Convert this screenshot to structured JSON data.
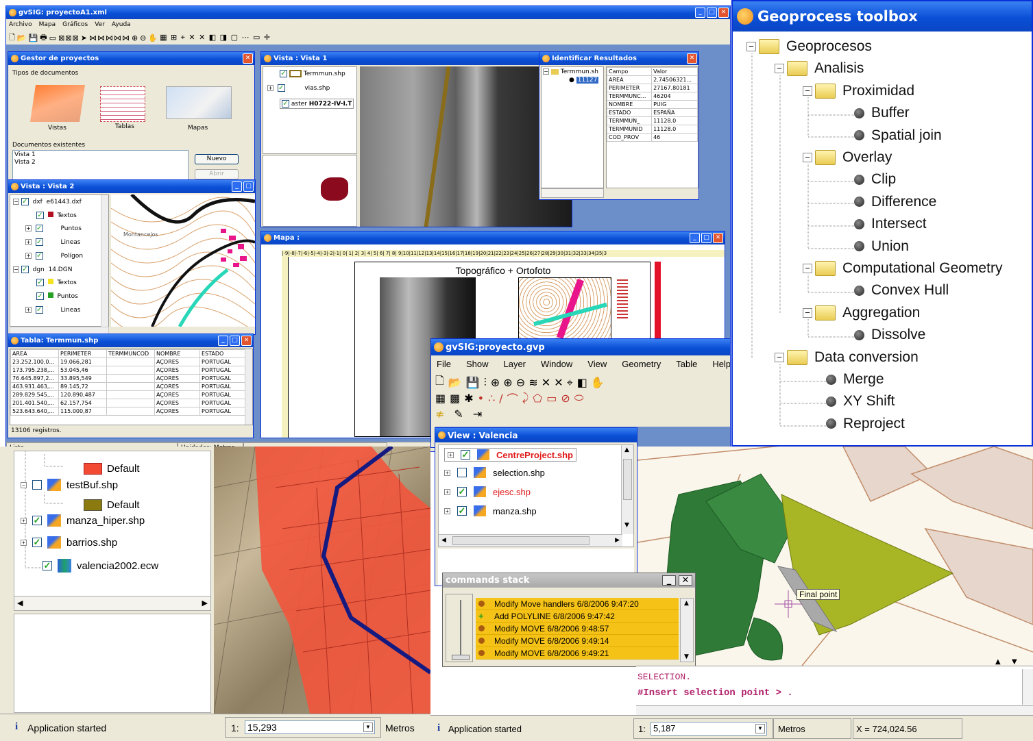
{
  "main": {
    "title": "gvSIG: proyectoA1.xml",
    "menu": [
      "Archivo",
      "Mapa",
      "Gráficos",
      "Ver",
      "Ayuda"
    ],
    "status": "Listo",
    "units": "Unidades: Metros"
  },
  "gestor": {
    "title": "Gestor de proyectos",
    "types_label": "Tipos de documentos",
    "types": [
      "Vistas",
      "Tablas",
      "Mapas"
    ],
    "docs_label": "Documentos existentes",
    "docs": [
      "Vista 1",
      "Vista 2"
    ],
    "new_btn": "Nuevo",
    "open_btn": "Abrir"
  },
  "vista1": {
    "title": "Vista : Vista 1",
    "layers": [
      "Termmun.shp",
      "vias.shp",
      "H0722-IV-I.T"
    ],
    "layer3_prefix": "aster"
  },
  "ident": {
    "title": "Identificar Resultados",
    "tree_root": "Termmun.sh",
    "tree_item": "11127",
    "col_field": "Campo",
    "col_value": "Valor",
    "rows": [
      [
        "AREA",
        "2.74506321..."
      ],
      [
        "PERIMETER",
        "27167.80181"
      ],
      [
        "TERMMUNC...",
        "46204"
      ],
      [
        "NOMBRE",
        "PUIG"
      ],
      [
        "ESTADO",
        "ESPAÑA"
      ],
      [
        "TERMMUN_",
        "11128.0"
      ],
      [
        "TERMMUNID",
        "11128.0"
      ],
      [
        "COD_PROV",
        "46"
      ]
    ]
  },
  "vista2": {
    "title": "Vista : Vista 2",
    "layers": [
      {
        "kind": "dxf",
        "name": "e61443.dxf"
      },
      {
        "name": "Textos"
      },
      {
        "name": "Puntos"
      },
      {
        "name": "Lineas"
      },
      {
        "name": "Polígon"
      },
      {
        "kind": "dgn",
        "name": "14.DGN"
      },
      {
        "name": "Textos"
      },
      {
        "name": "Puntos"
      },
      {
        "name": "Lineas"
      }
    ],
    "map_label": "Montancejos"
  },
  "tabla": {
    "title": "Tabla: Termmun.shp",
    "headers": [
      "AREA",
      "PERIMETER",
      "TERMMUNCOD",
      "NOMBRE",
      "ESTADO"
    ],
    "rows": [
      [
        "23.252.100,0...",
        "19.066,281",
        "",
        "AÇORES",
        "PORTUGAL"
      ],
      [
        "173.795.238,...",
        "53.045,46",
        "",
        "AÇORES",
        "PORTUGAL"
      ],
      [
        "76.645.897,2...",
        "33.895,549",
        "",
        "AÇORES",
        "PORTUGAL"
      ],
      [
        "463.931.463,...",
        "89.145,72",
        "",
        "AÇORES",
        "PORTUGAL"
      ],
      [
        "289.829.545,...",
        "120.890,487",
        "",
        "AÇORES",
        "PORTUGAL"
      ],
      [
        "201.401.540,...",
        "62.157,754",
        "",
        "AÇORES",
        "PORTUGAL"
      ],
      [
        "523.643.640,...",
        "115.000,87",
        "",
        "AÇORES",
        "PORTUGAL"
      ]
    ],
    "count": "13106 registros."
  },
  "mapa": {
    "title": "Mapa :",
    "heading": "Topográfico + Ortofoto",
    "ruler": "|-9|-8|-7|-6|-5|-4|-3|-2|-1| 0| 1| 2| 3| 4| 5| 6| 7| 8| 9|10|11|12|13|14|15|16|17|18|19|20|21|22|23|24|25|26|27|28|29|30|31|32|33|34|35|3"
  },
  "toolbox": {
    "title": "Geoprocess toolbox",
    "tree": [
      {
        "label": "Geoprocesos",
        "kind": "folder"
      },
      {
        "label": "Analisis",
        "kind": "folder"
      },
      {
        "label": "Proximidad",
        "kind": "folder"
      },
      {
        "label": "Buffer",
        "kind": "leaf"
      },
      {
        "label": "Spatial join",
        "kind": "leaf"
      },
      {
        "label": "Overlay",
        "kind": "folder"
      },
      {
        "label": "Clip",
        "kind": "leaf"
      },
      {
        "label": "Difference",
        "kind": "leaf"
      },
      {
        "label": "Intersect",
        "kind": "leaf"
      },
      {
        "label": "Union",
        "kind": "leaf"
      },
      {
        "label": "Computational Geometry",
        "kind": "folder"
      },
      {
        "label": "Convex Hull",
        "kind": "leaf"
      },
      {
        "label": "Aggregation",
        "kind": "folder"
      },
      {
        "label": "Dissolve",
        "kind": "leaf"
      },
      {
        "label": "Data conversion",
        "kind": "folder"
      },
      {
        "label": "Merge",
        "kind": "leaf"
      },
      {
        "label": "XY Shift",
        "kind": "leaf"
      },
      {
        "label": "Reproject",
        "kind": "leaf"
      }
    ]
  },
  "proyecto": {
    "title": "gvSIG:proyecto.gvp",
    "menu": [
      "File",
      "Show",
      "Layer",
      "Window",
      "View",
      "Geometry",
      "Table",
      "Help"
    ]
  },
  "valencia": {
    "title": "View : Valencia",
    "layers": [
      {
        "name": "CentreProject.shp",
        "checked": true,
        "red": true
      },
      {
        "name": "selection.shp",
        "checked": false,
        "red": false
      },
      {
        "name": "ejesc.shp",
        "checked": true,
        "red": true
      },
      {
        "name": "manza.shp",
        "checked": true,
        "red": false
      }
    ]
  },
  "leftlegend": {
    "items": [
      "Default",
      "testBuf.shp",
      "Default",
      "manza_hiper.shp",
      "barrios.shp",
      "valencia2002.ecw"
    ]
  },
  "cmdstack": {
    "title": "commands stack",
    "items": [
      {
        "text": "Modify Move handlers 6/8/2006 9:47:20",
        "kind": "dot"
      },
      {
        "text": "Add POLYLINE 6/8/2006 9:47:42",
        "kind": "plus"
      },
      {
        "text": "Modify MOVE 6/8/2006 9:48:57",
        "kind": "dot"
      },
      {
        "text": "Modify MOVE 6/8/2006 9:49:14",
        "kind": "dot"
      },
      {
        "text": "Modify MOVE 6/8/2006 9:49:21",
        "kind": "dot"
      }
    ]
  },
  "cad": {
    "tooltip": "Final point",
    "console_lines": [
      "SELECTION.",
      "#Insert selection point > ."
    ]
  },
  "status_left": {
    "message": "Application started",
    "scale_prefix": "1:",
    "scale": "15,293",
    "units": "Metros"
  },
  "status_right": {
    "message": "Application started",
    "scale_prefix": "1:",
    "scale": "5,187",
    "units": "Metros",
    "coord": "X = 724,024.56"
  }
}
